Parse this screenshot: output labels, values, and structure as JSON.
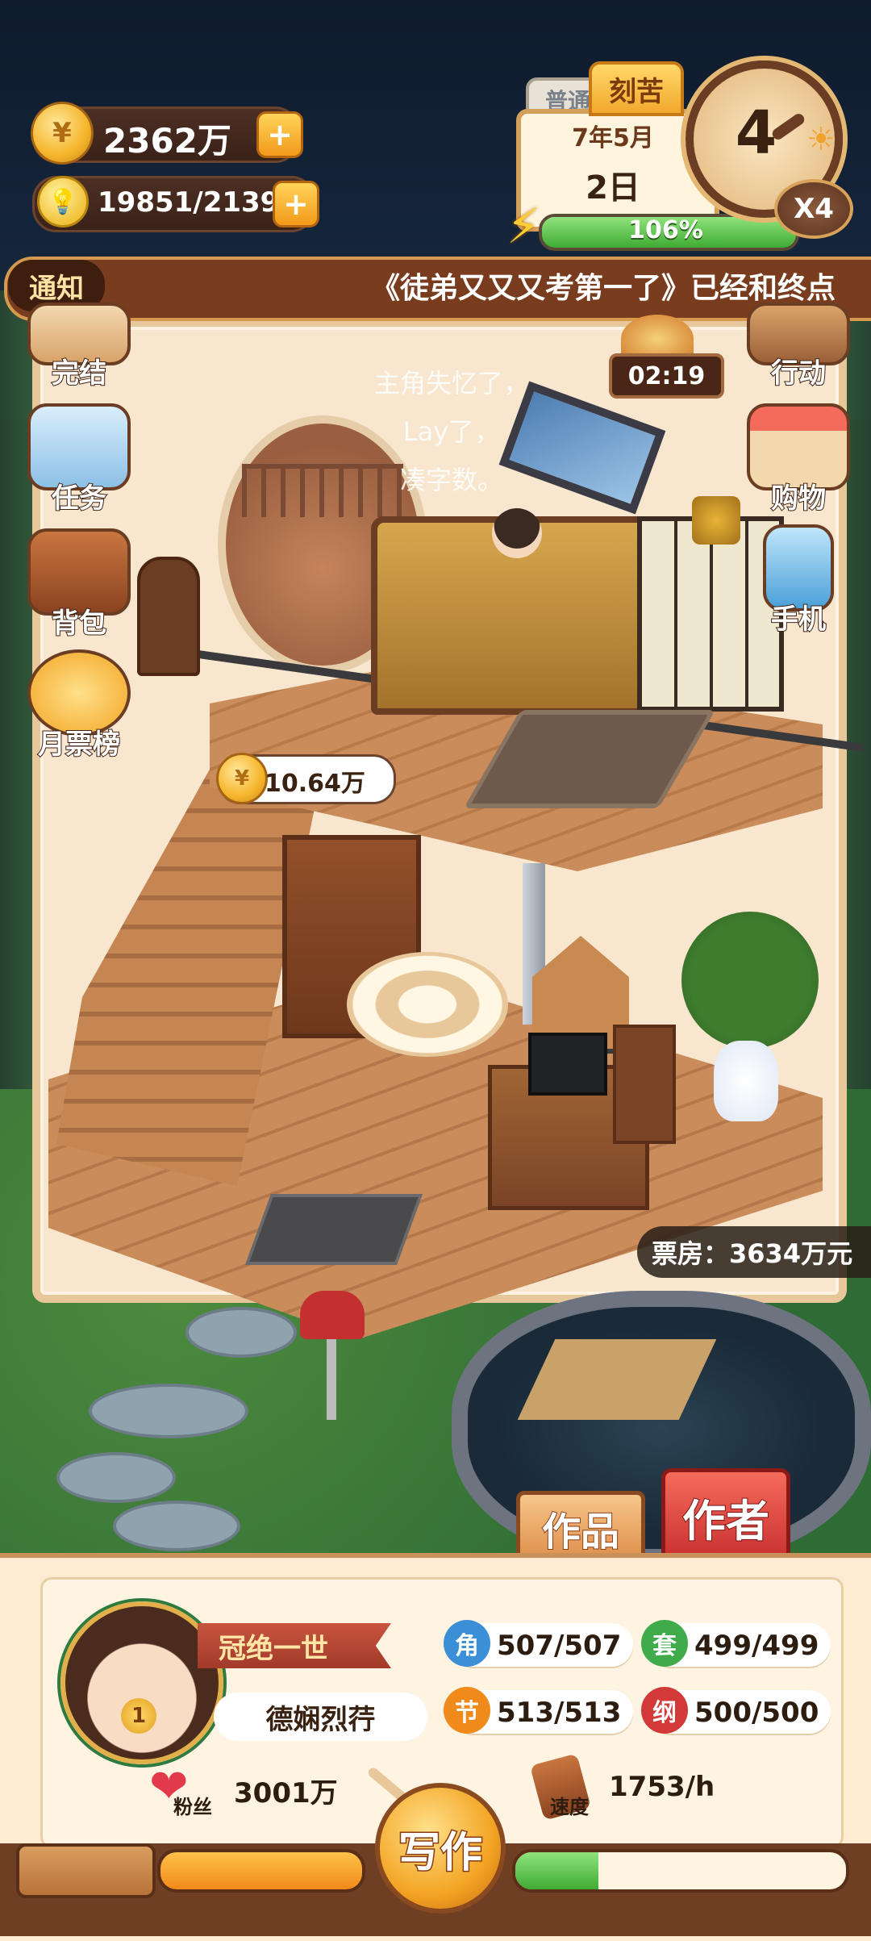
{
  "hud": {
    "coins": "2362万",
    "energy": "19851/21399",
    "plus": "+",
    "coin_symbol": "¥",
    "bulb_symbol": "💡"
  },
  "calendar": {
    "tab_normal": "普通",
    "tab_hard": "刻苦",
    "month": "7年5月",
    "day": "2日",
    "progress_text": "106%",
    "progress_fraction": 1.0,
    "dial_value": "4",
    "speed": "X4"
  },
  "notice": {
    "tag": "通知",
    "text": "《徒弟又又又考第一了》已经和终点"
  },
  "side_left": [
    {
      "label": "完结",
      "icon": "scroll-icon"
    },
    {
      "label": "任务",
      "icon": "checklist-icon"
    },
    {
      "label": "背包",
      "icon": "backpack-icon"
    },
    {
      "label": "月票榜",
      "icon": "ticket-coin-icon"
    }
  ],
  "side_right": [
    {
      "label": "行动",
      "icon": "door-icon"
    },
    {
      "label": "购物",
      "icon": "shop-icon"
    },
    {
      "label": "手机",
      "icon": "phone-icon"
    }
  ],
  "timer": "02:19",
  "story_lines": [
    "主角失忆了，",
    "Lay了，",
    "凑字数。"
  ],
  "income": "10.64万",
  "box_office": "票房：3634万元",
  "buttons": {
    "works": "作品",
    "author": "作者",
    "write": "写作"
  },
  "profile": {
    "title": "冠绝一世",
    "name": "德娴烈荇",
    "avatar_badge": "1",
    "stats": [
      {
        "icon_char": "角",
        "value": "507/507",
        "color": "#3b8fd6"
      },
      {
        "icon_char": "套",
        "value": "499/499",
        "color": "#3fab4a"
      },
      {
        "icon_char": "节",
        "value": "513/513",
        "color": "#f08a1a"
      },
      {
        "icon_char": "纲",
        "value": "500/500",
        "color": "#d23a3a"
      }
    ],
    "fans_label": "粉丝",
    "fans_value": "3001万",
    "speed_label": "速度",
    "speed_value": "1753/h"
  },
  "bottom": {
    "orange_fraction": 1.0,
    "green_fraction": 0.25
  },
  "colors": {
    "accent": "#f3a524",
    "panel": "#fdebd2",
    "notice": "#7a3c1e"
  }
}
